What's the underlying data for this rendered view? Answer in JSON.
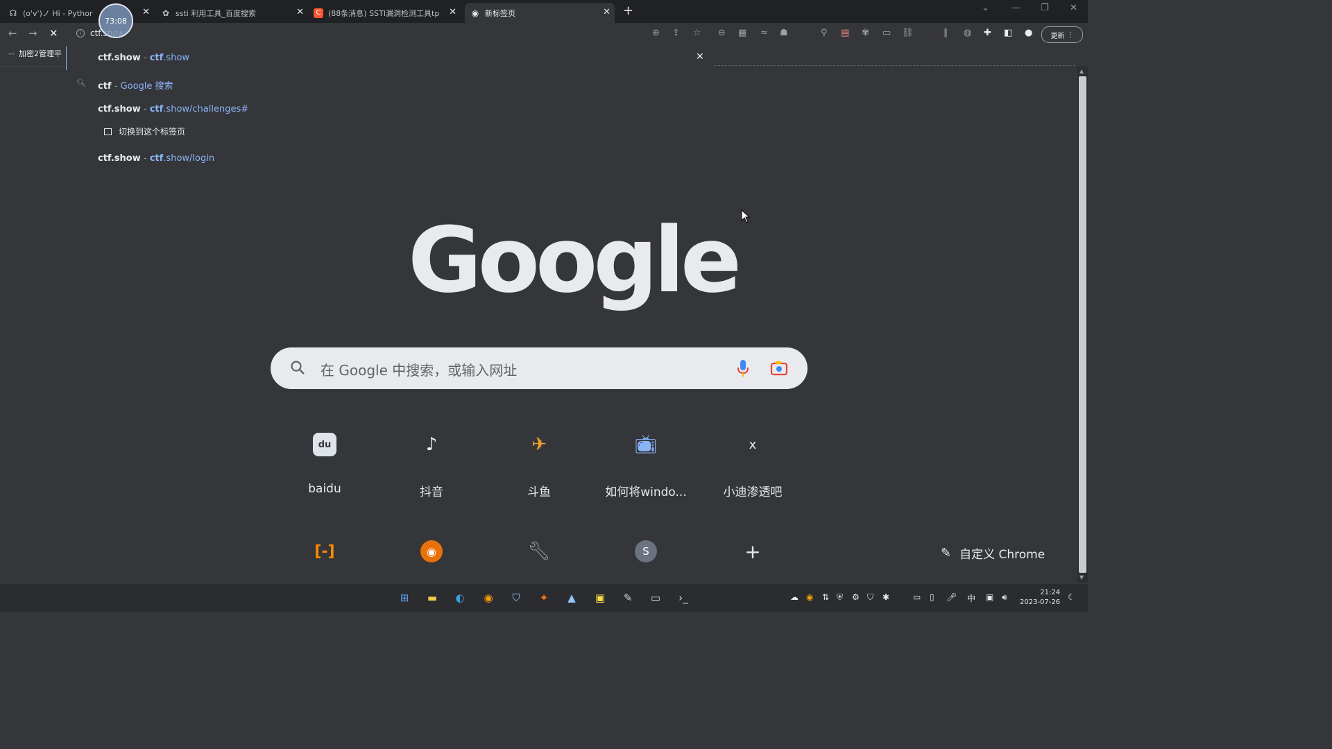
{
  "tabs": [
    {
      "title": "(o'v')ノ Hi - Pythor",
      "icon": "chatbot-icon"
    },
    {
      "title": "ssti 利用工具_百度搜索",
      "icon": "baidu-paw-icon"
    },
    {
      "title": "(88条消息) SSTI漏洞检测工具tp",
      "icon": "csdn-icon"
    },
    {
      "title": "新标签页",
      "icon": "chrome-icon"
    }
  ],
  "recording_timer": "73:08",
  "omnibox": {
    "text": "ctf.show"
  },
  "toolbar": {
    "update_label": "更新"
  },
  "bookmarks": [
    {
      "label": "加密2管理平",
      "icon": "bookmark-icon"
    }
  ],
  "suggestions": [
    {
      "bold": "ctf.show",
      "sep": " - ",
      "url_bold": "ctf",
      "url": ".show"
    },
    {
      "bold": "ctf",
      "sep": " - ",
      "rest": "Google 搜索"
    },
    {
      "bold": "ctf.show",
      "sep": " - ",
      "url_bold": "ctf",
      "url": ".show/challenges#"
    },
    {
      "action": "切换到这个标签页"
    },
    {
      "bold": "ctf.show",
      "sep": " - ",
      "url_bold": "ctf",
      "url": ".show/login"
    }
  ],
  "google": {
    "logo_text": "Google",
    "search_placeholder": "在 Google 中搜索，或输入网址"
  },
  "shortcuts": [
    {
      "label": "baidu",
      "icon": "baidu-icon"
    },
    {
      "label": "抖音",
      "icon": "douyin-icon"
    },
    {
      "label": "斗鱼",
      "icon": "douyu-icon"
    },
    {
      "label": "如何将windo...",
      "icon": "bilibili-icon"
    },
    {
      "label": "小迪渗透吧",
      "icon": "x-letter-icon"
    },
    {
      "label": "",
      "icon": "aliyun-icon"
    },
    {
      "label": "",
      "icon": "chrome-like-icon"
    },
    {
      "label": "",
      "icon": "wrench-icon"
    },
    {
      "label": "",
      "icon": "s-avatar-icon"
    },
    {
      "label": "",
      "icon": "add-shortcut-icon"
    }
  ],
  "shortcut_s_letter": "S",
  "customize_label": "自定义 Chrome",
  "clock": {
    "time": "21:24",
    "date": "2023-07-26"
  },
  "tray": {
    "ime": "中"
  },
  "colors": {
    "background": "#35363a",
    "tabstrip": "#202124",
    "link": "#8ab4f8",
    "searchbox": "#e8eaed"
  }
}
